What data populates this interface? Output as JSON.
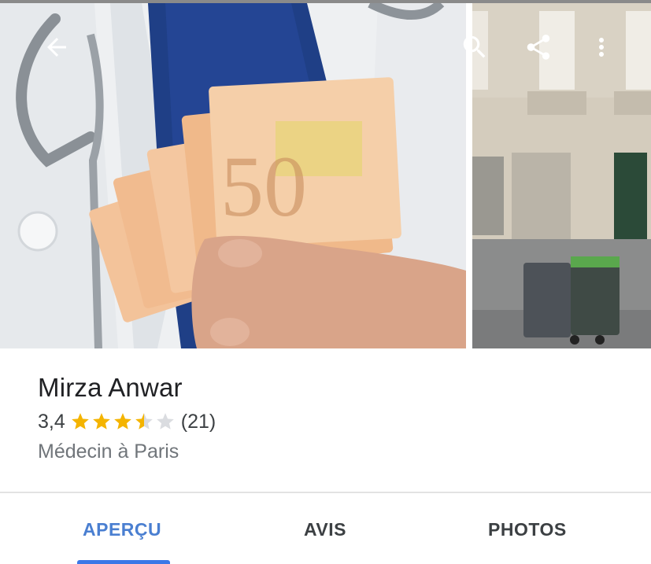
{
  "header": {
    "back_icon": "arrow-left-icon",
    "search_icon": "search-icon",
    "share_icon": "share-icon",
    "more_icon": "more-vert-icon"
  },
  "photos": [
    {
      "subject": "doctor-holding-euro-banknotes"
    },
    {
      "subject": "building-facade-with-bins"
    }
  ],
  "place": {
    "name": "Mirza Anwar",
    "rating": "3,4",
    "rating_value": 3.4,
    "stars_max": 5,
    "review_count": "(21)",
    "category": "Médecin à Paris"
  },
  "tabs": [
    {
      "label": "APERÇU",
      "active": true
    },
    {
      "label": "AVIS",
      "active": false
    },
    {
      "label": "PHOTOS",
      "active": false
    }
  ],
  "colors": {
    "star": "#f4b400",
    "star_empty": "#dadce0",
    "active_tab": "#4a7fd1",
    "indicator": "#3b78e7"
  }
}
